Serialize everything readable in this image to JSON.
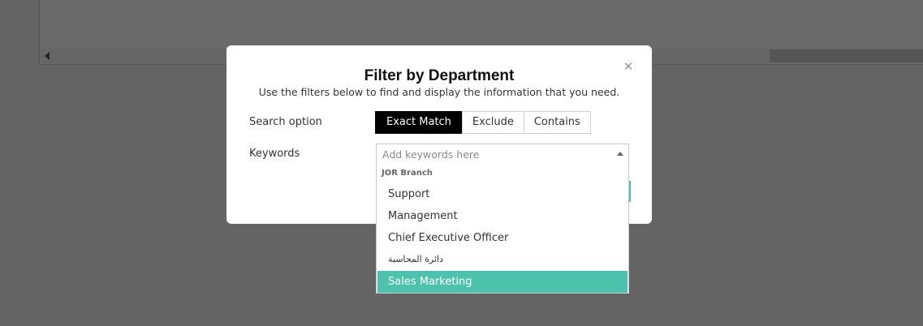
{
  "modal": {
    "title": "Filter by Department",
    "subtitle": "Use the filters below to find and display the information that you need.",
    "close_icon": "close-icon"
  },
  "search_option": {
    "label": "Search option",
    "buttons": [
      {
        "label": "Exact Match",
        "active": true
      },
      {
        "label": "Exclude",
        "active": false
      },
      {
        "label": "Contains",
        "active": false
      }
    ]
  },
  "keywords": {
    "label": "Keywords",
    "placeholder": "Add keywords here",
    "value": ""
  },
  "dropdown": {
    "group": "JOR Branch",
    "options": [
      {
        "label": "Support"
      },
      {
        "label": "Management"
      },
      {
        "label": "Chief Executive Officer"
      },
      {
        "label": "دائرة المحاسبة"
      },
      {
        "label": "Sales Marketing",
        "highlighted": true
      }
    ]
  },
  "colors": {
    "overlay": "#646464",
    "accent": "#4dc2ad",
    "active_button": "#000000"
  }
}
